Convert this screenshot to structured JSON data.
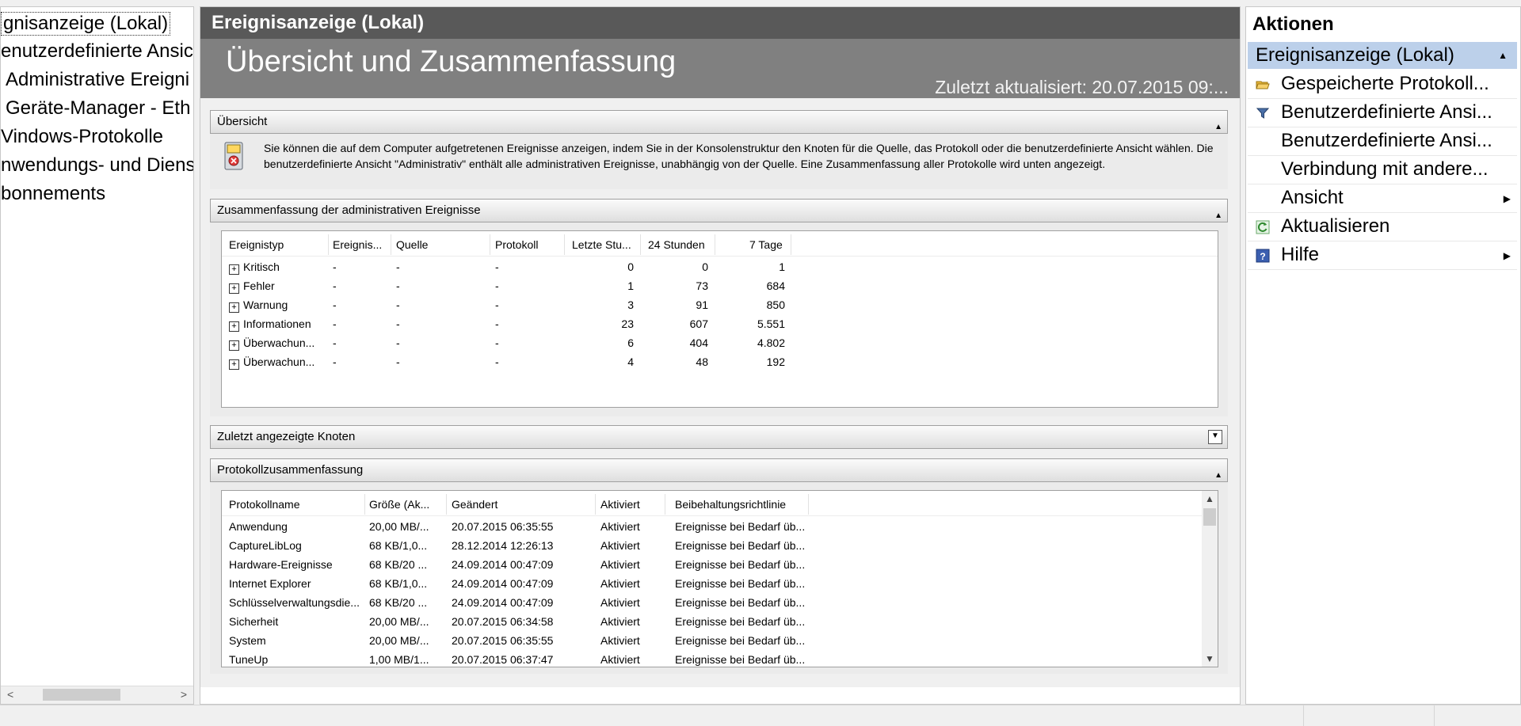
{
  "tree": {
    "items": [
      {
        "label": "gnisanzeige (Lokal)",
        "selected": true
      },
      {
        "label": "enutzerdefinierte Ansic"
      },
      {
        "label": "Administrative Ereigni"
      },
      {
        "label": "Geräte-Manager - Eth"
      },
      {
        "label": "Vindows-Protokolle"
      },
      {
        "label": "nwendungs- und Diens"
      },
      {
        "label": "bonnements"
      }
    ]
  },
  "center": {
    "title": "Ereignisanzeige (Lokal)",
    "heading": "Übersicht und Zusammenfassung",
    "timestamp": "Zuletzt aktualisiert: 20.07.2015 09:..."
  },
  "overview": {
    "title": "Übersicht",
    "text": "Sie können die auf dem Computer aufgetretenen Ereignisse anzeigen, indem Sie in der Konsolenstruktur den Knoten für die Quelle, das Protokoll oder die benutzerdefinierte Ansicht wählen. Die benutzerdefinierte Ansicht \"Administrativ\" enthält alle administrativen Ereignisse, unabhängig von der Quelle. Eine Zusammenfassung aller Protokolle wird unten angezeigt."
  },
  "admin_summary": {
    "title": "Zusammenfassung der administrativen Ereignisse",
    "columns": [
      "Ereignistyp",
      "Ereignis...",
      "Quelle",
      "Protokoll",
      "Letzte Stu...",
      "24 Stunden",
      "7 Tage"
    ],
    "rows": [
      [
        "Kritisch",
        "-",
        "-",
        "-",
        "0",
        "0",
        "1"
      ],
      [
        "Fehler",
        "-",
        "-",
        "-",
        "1",
        "73",
        "684"
      ],
      [
        "Warnung",
        "-",
        "-",
        "-",
        "3",
        "91",
        "850"
      ],
      [
        "Informationen",
        "-",
        "-",
        "-",
        "23",
        "607",
        "5.551"
      ],
      [
        "Überwachun...",
        "-",
        "-",
        "-",
        "6",
        "404",
        "4.802"
      ],
      [
        "Überwachun...",
        "-",
        "-",
        "-",
        "4",
        "48",
        "192"
      ]
    ]
  },
  "recent_nodes": {
    "title": "Zuletzt angezeigte Knoten"
  },
  "log_summary": {
    "title": "Protokollzusammenfassung",
    "columns": [
      "Protokollname",
      "Größe (Ak...",
      "Geändert",
      "Aktiviert",
      "Beibehaltungsrichtlinie"
    ],
    "rows": [
      [
        "Anwendung",
        "20,00 MB/...",
        "20.07.2015 06:35:55",
        "Aktiviert",
        "Ereignisse bei Bedarf üb..."
      ],
      [
        "CaptureLibLog",
        "68 KB/1,0...",
        "28.12.2014 12:26:13",
        "Aktiviert",
        "Ereignisse bei Bedarf üb..."
      ],
      [
        "Hardware-Ereignisse",
        "68 KB/20 ...",
        "24.09.2014 00:47:09",
        "Aktiviert",
        "Ereignisse bei Bedarf üb..."
      ],
      [
        "Internet Explorer",
        "68 KB/1,0...",
        "24.09.2014 00:47:09",
        "Aktiviert",
        "Ereignisse bei Bedarf üb..."
      ],
      [
        "Schlüsselverwaltungsdie...",
        "68 KB/20 ...",
        "24.09.2014 00:47:09",
        "Aktiviert",
        "Ereignisse bei Bedarf üb..."
      ],
      [
        "Sicherheit",
        "20,00 MB/...",
        "20.07.2015 06:34:58",
        "Aktiviert",
        "Ereignisse bei Bedarf üb..."
      ],
      [
        "System",
        "20,00 MB/...",
        "20.07.2015 06:35:55",
        "Aktiviert",
        "Ereignisse bei Bedarf üb..."
      ],
      [
        "TuneUp",
        "1,00 MB/1...",
        "20.07.2015 06:37:47",
        "Aktiviert",
        "Ereignisse bei Bedarf üb..."
      ]
    ]
  },
  "actions": {
    "title": "Aktionen",
    "group": "Ereignisanzeige (Lokal)",
    "items": [
      {
        "label": "Gespeicherte Protokoll...",
        "icon": "folder-open-icon"
      },
      {
        "label": "Benutzerdefinierte Ansi...",
        "icon": "filter-icon"
      },
      {
        "label": "Benutzerdefinierte Ansi...",
        "icon": ""
      },
      {
        "label": "Verbindung mit andere...",
        "icon": ""
      },
      {
        "label": "Ansicht",
        "icon": "",
        "submenu": true
      },
      {
        "label": "Aktualisieren",
        "icon": "refresh-icon"
      },
      {
        "label": "Hilfe",
        "icon": "help-icon",
        "submenu": true
      }
    ]
  },
  "colors": {
    "title_bar": "#595959",
    "banner": "#808080",
    "selection": "#bcd0ea"
  }
}
